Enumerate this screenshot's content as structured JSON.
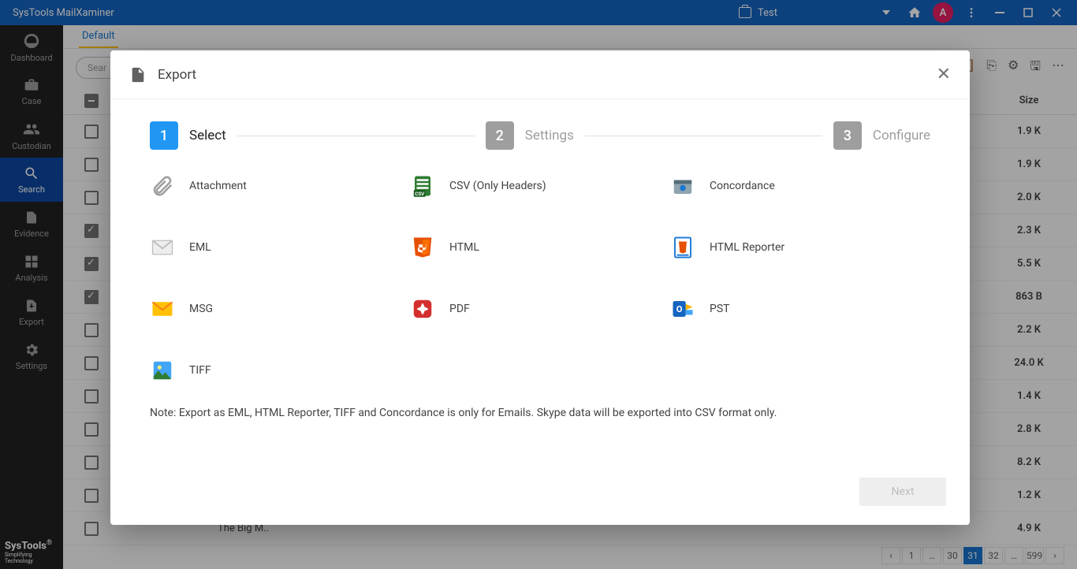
{
  "titlebar": {
    "app_name": "SysTools MailXaminer",
    "case_label": "Test",
    "avatar_letter": "A"
  },
  "sidebar": {
    "items": [
      {
        "label": "Dashboard"
      },
      {
        "label": "Case"
      },
      {
        "label": "Custodian"
      },
      {
        "label": "Search"
      },
      {
        "label": "Evidence"
      },
      {
        "label": "Analysis"
      },
      {
        "label": "Export"
      },
      {
        "label": "Settings"
      }
    ],
    "brand": "SysTools",
    "brand_sub": "Simplifying Technology"
  },
  "tabs": {
    "default": "Default"
  },
  "search": {
    "placeholder": "Sear"
  },
  "table": {
    "size_header": "Size",
    "rows": [
      {
        "checked": false,
        "size": "1.9 K"
      },
      {
        "checked": false,
        "size": "1.9 K"
      },
      {
        "checked": false,
        "size": "2.0 K"
      },
      {
        "checked": true,
        "size": "2.3 K"
      },
      {
        "checked": true,
        "size": "5.5 K"
      },
      {
        "checked": true,
        "size": "863 B"
      },
      {
        "checked": false,
        "size": "2.2 K"
      },
      {
        "checked": false,
        "size": "24.0 K"
      },
      {
        "checked": false,
        "size": "1.4 K"
      },
      {
        "checked": false,
        "size": "2.8 K"
      },
      {
        "checked": false,
        "size": "8.2 K"
      },
      {
        "checked": false,
        "size": "1.2 K"
      },
      {
        "checked": false,
        "size": "4.9 K"
      }
    ],
    "last_subject": "The Big M.."
  },
  "pager": {
    "pages": [
      "1",
      "…",
      "30",
      "31",
      "32",
      "…",
      "599"
    ],
    "active": "31"
  },
  "modal": {
    "title": "Export",
    "steps": [
      {
        "num": "1",
        "label": "Select",
        "active": true
      },
      {
        "num": "2",
        "label": "Settings",
        "active": false
      },
      {
        "num": "3",
        "label": "Configure",
        "active": false
      }
    ],
    "options": [
      {
        "key": "attachment",
        "label": "Attachment"
      },
      {
        "key": "csv",
        "label": "CSV (Only Headers)"
      },
      {
        "key": "concordance",
        "label": "Concordance"
      },
      {
        "key": "eml",
        "label": "EML"
      },
      {
        "key": "html",
        "label": "HTML"
      },
      {
        "key": "html_reporter",
        "label": "HTML Reporter"
      },
      {
        "key": "msg",
        "label": "MSG"
      },
      {
        "key": "pdf",
        "label": "PDF"
      },
      {
        "key": "pst",
        "label": "PST"
      },
      {
        "key": "tiff",
        "label": "TIFF"
      }
    ],
    "note": "Note: Export as EML, HTML Reporter, TIFF and Concordance is only for Emails. Skype data will be exported into CSV format only.",
    "next_label": "Next"
  }
}
